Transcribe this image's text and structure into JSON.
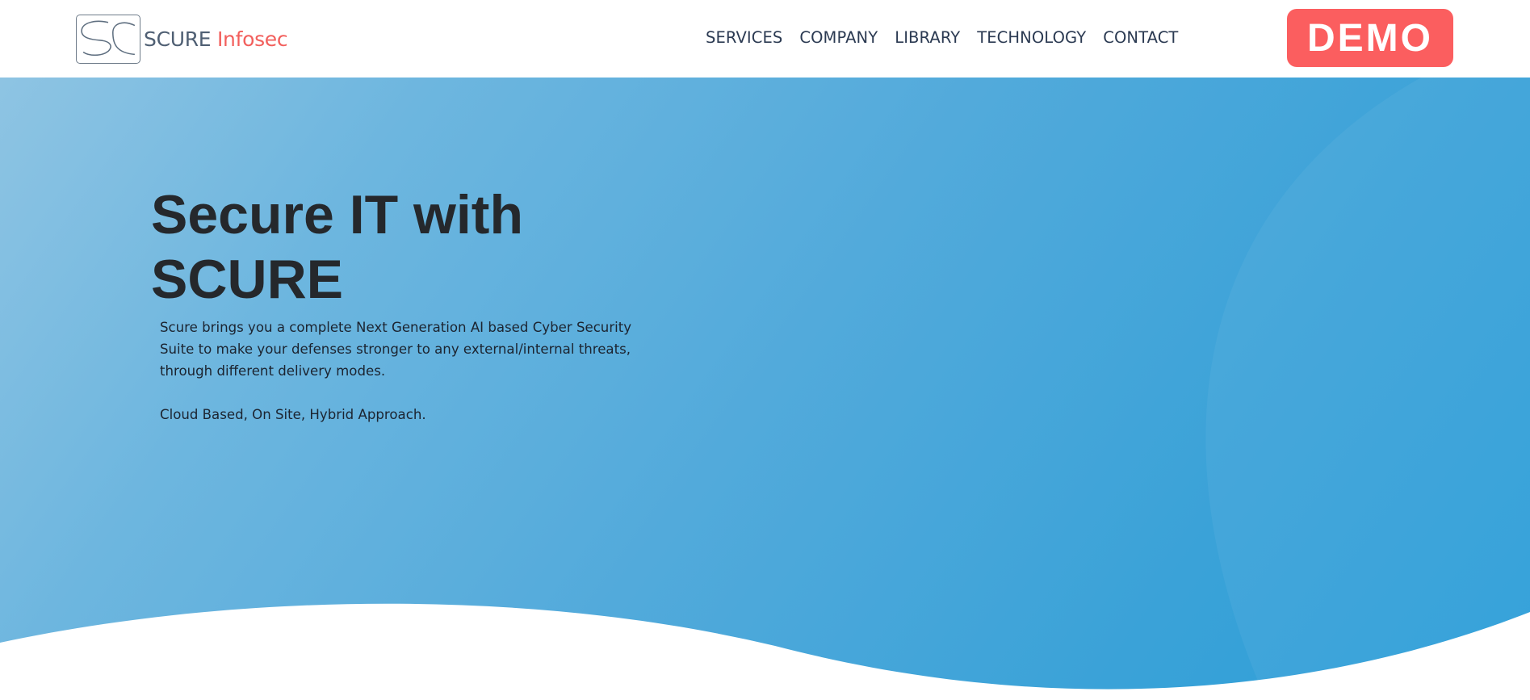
{
  "brand": {
    "name_main": "SCURE",
    "name_accent": "Infosec",
    "text_color": "#4f5f73",
    "accent_color": "#f25f5c"
  },
  "nav": {
    "items": [
      {
        "label": "SERVICES"
      },
      {
        "label": "COMPANY"
      },
      {
        "label": "LIBRARY"
      },
      {
        "label": "TECHNOLOGY"
      },
      {
        "label": "CONTACT"
      }
    ]
  },
  "demo_button": {
    "label": "DEMO",
    "color": "#fb5e5f"
  },
  "hero": {
    "title_line1": "Secure IT with",
    "title_line2": "SCURE",
    "description": "Scure brings you a complete Next Generation AI based Cyber Security Suite to make your defenses stronger to any external/internal threats, through different delivery modes.",
    "modes": "Cloud Based, On Site, Hybrid Approach.",
    "gradient_start": "#8ec4e3",
    "gradient_end": "#2b9ed8"
  }
}
